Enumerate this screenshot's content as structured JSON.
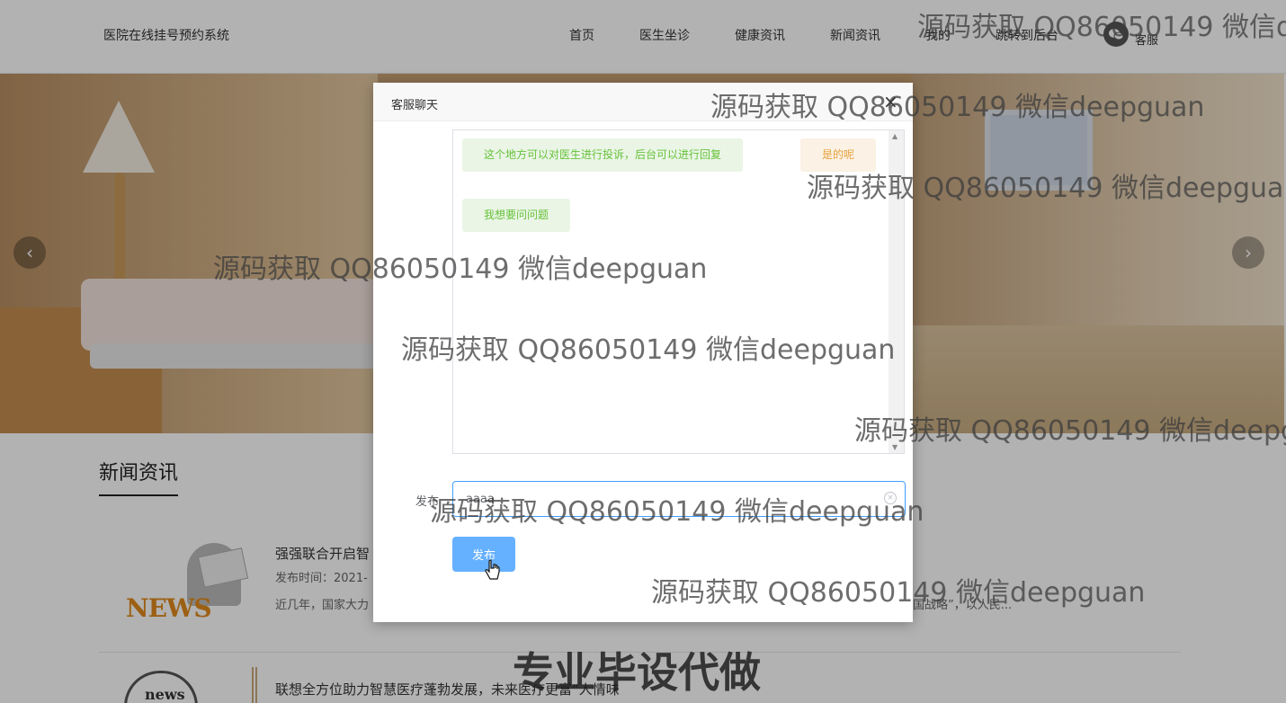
{
  "header": {
    "site_title": "医院在线挂号预约系统",
    "nav": [
      "首页",
      "医生坐诊",
      "健康资讯",
      "新闻资讯",
      "我的",
      "跳转到后台"
    ],
    "service_label": "客服",
    "service_icon": "wechat-icon"
  },
  "banner": {
    "prev_icon": "chevron-left-icon",
    "next_icon": "chevron-right-icon",
    "prev_glyph": "‹",
    "next_glyph": "›"
  },
  "news": {
    "section_title": "新闻资讯",
    "items": [
      {
        "headline": "强强联合开启智",
        "time": "发布时间：2021-",
        "desc": "近几年，国家大力",
        "desc_tail": "国战略”，以人民...",
        "image_text": "NEWS"
      },
      {
        "headline": "联想全方位助力智慧医疗蓬勃发展，未来医疗更富“人情味",
        "image_text": "news"
      }
    ]
  },
  "dialog": {
    "title": "客服聊天",
    "close_glyph": "×",
    "messages": [
      {
        "text": "这个地方可以对医生进行投诉，后台可以进行回复",
        "side": "left",
        "color": "#67c23a"
      },
      {
        "text": "是的呢",
        "side": "right",
        "color": "#e6a23c"
      },
      {
        "text": "我想要问问题",
        "side": "left",
        "color": "#67c23a"
      }
    ],
    "input_label": "发布",
    "input_value": "aaaa",
    "send_label": "发布",
    "accent": "#409eff"
  },
  "watermarks": {
    "text": "源码获取 QQ86050149 微信deepguan",
    "text_cut": "源码获取 QQ86050149 微信d",
    "text_cut2": "源码获取 QQ86050149 微信deepg",
    "big": "专业毕设代做"
  }
}
